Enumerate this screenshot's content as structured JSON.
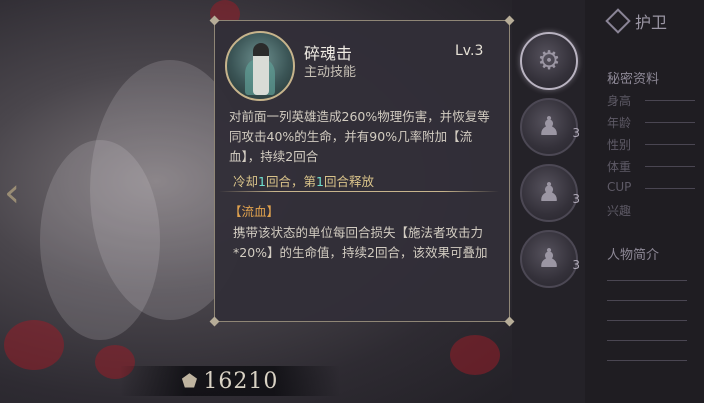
{
  "skill": {
    "name": "碎魂击",
    "type": "主动技能",
    "level": "Lv.3",
    "description": "对前面一列英雄造成260%物理伤害，并恢复等同攻击40%的生命，并有90%几率附加【流血】，持续2回合",
    "cooldown_prefix": "冷却",
    "cooldown_turns": "1",
    "cooldown_mid": "回合，第",
    "release_turn": "1",
    "cooldown_suffix": "回合释放",
    "effect_title": "【流血】",
    "effect_description": "携带该状态的单位每回合损失【施法者攻击力*20%】的生命值，持续2回合，该效果可叠加"
  },
  "skill_slots": [
    {
      "icon": "gear-icon",
      "level": "",
      "active": true
    },
    {
      "icon": "figure-icon",
      "level": "3",
      "active": false
    },
    {
      "icon": "figure-icon",
      "level": "3",
      "active": false
    },
    {
      "icon": "figure-icon",
      "level": "3",
      "active": false
    }
  ],
  "right_panel": {
    "header": "护卫",
    "secret_section": "秘密资料",
    "rows": [
      "身高",
      "年龄",
      "性别",
      "体重",
      "CUP",
      "兴趣"
    ],
    "intro_section": "人物简介"
  },
  "power": {
    "value": "16210",
    "icon": "power-icon"
  },
  "colors": {
    "accent_gold": "#c7b48c",
    "cooldown_highlight": "#6fe0cf",
    "effect_title": "#e0a24e"
  }
}
